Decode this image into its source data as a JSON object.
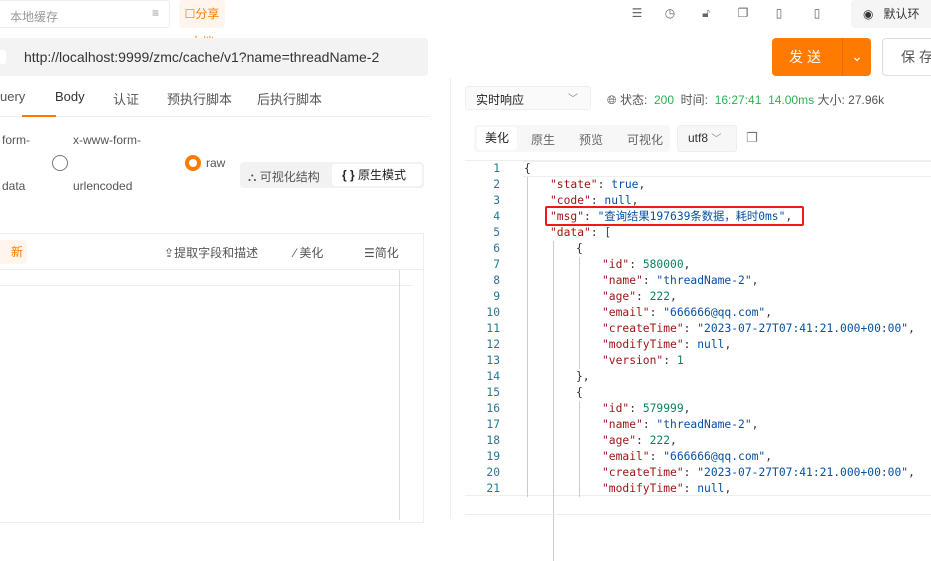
{
  "topbar": {
    "search_placeholder": "本地缓存",
    "share_label": "分享文档",
    "env_label": "默认环",
    "icons": [
      "list-icon",
      "clock-icon",
      "lock-icon",
      "copy-icon",
      "code-icon",
      "flash-icon"
    ]
  },
  "request": {
    "url": "http://localhost:9999/zmc/cache/v1?name=threadName-2",
    "send_label": "发送",
    "save_label": "保存"
  },
  "req_tabs": [
    {
      "label": "uery"
    },
    {
      "label": "Body",
      "active": true
    },
    {
      "label": "认证"
    },
    {
      "label": "预执行脚本"
    },
    {
      "label": "后执行脚本"
    }
  ],
  "body_types": {
    "form_data_1": "form-",
    "form_data_2": "data",
    "urlenc_1": "x-www-form-",
    "urlenc_2": "urlencoded",
    "raw": "raw",
    "selected": "raw"
  },
  "view_toggle": {
    "visual": "可视化结构",
    "raw": "原生模式"
  },
  "left_toolbar": {
    "new": "新",
    "extract": "提取字段和描述",
    "beautify": "美化",
    "simplify": "简化"
  },
  "response": {
    "mode": "实时响应",
    "status_label": "状态:",
    "status": "200",
    "time_label": "时间:",
    "time": "16:27:41",
    "duration": "14.00ms",
    "size_label": "大小:",
    "size": "27.96k",
    "tabs": [
      "美化",
      "原生",
      "预览",
      "可视化"
    ],
    "active_tab": "美化",
    "encoding": "utf8"
  },
  "colors": {
    "accent": "#ff7a00",
    "success": "#2bb24c",
    "highlight_box": "#f01818"
  },
  "code_lines": [
    {
      "i": 0,
      "t": [
        [
          "p",
          "{"
        ]
      ]
    },
    {
      "i": 1,
      "t": [
        [
          "k",
          "\"state\""
        ],
        [
          "p",
          ": "
        ],
        [
          "b",
          "true"
        ],
        [
          "p",
          ","
        ]
      ]
    },
    {
      "i": 1,
      "t": [
        [
          "k",
          "\"code\""
        ],
        [
          "p",
          ": "
        ],
        [
          "b",
          "null"
        ],
        [
          "p",
          ","
        ]
      ]
    },
    {
      "i": 1,
      "t": [
        [
          "k",
          "\"msg\""
        ],
        [
          "p",
          ": "
        ],
        [
          "s",
          "\"查询结果197639条数据，耗时0ms\""
        ],
        [
          "p",
          ","
        ]
      ]
    },
    {
      "i": 1,
      "t": [
        [
          "k",
          "\"data\""
        ],
        [
          "p",
          ": "
        ],
        [
          "s",
          "["
        ]
      ]
    },
    {
      "i": 2,
      "t": [
        [
          "p",
          "{"
        ]
      ]
    },
    {
      "i": 3,
      "t": [
        [
          "k",
          "\"id\""
        ],
        [
          "p",
          ": "
        ],
        [
          "n",
          "580000"
        ],
        [
          "p",
          ","
        ]
      ]
    },
    {
      "i": 3,
      "t": [
        [
          "k",
          "\"name\""
        ],
        [
          "p",
          ": "
        ],
        [
          "s",
          "\"threadName-2\""
        ],
        [
          "p",
          ","
        ]
      ]
    },
    {
      "i": 3,
      "t": [
        [
          "k",
          "\"age\""
        ],
        [
          "p",
          ": "
        ],
        [
          "n",
          "222"
        ],
        [
          "p",
          ","
        ]
      ]
    },
    {
      "i": 3,
      "t": [
        [
          "k",
          "\"email\""
        ],
        [
          "p",
          ": "
        ],
        [
          "s",
          "\"666666@qq.com\""
        ],
        [
          "p",
          ","
        ]
      ]
    },
    {
      "i": 3,
      "t": [
        [
          "k",
          "\"createTime\""
        ],
        [
          "p",
          ": "
        ],
        [
          "s",
          "\"2023-07-27T07:41:21.000+00:00\""
        ],
        [
          "p",
          ","
        ]
      ]
    },
    {
      "i": 3,
      "t": [
        [
          "k",
          "\"modifyTime\""
        ],
        [
          "p",
          ": "
        ],
        [
          "b",
          "null"
        ],
        [
          "p",
          ","
        ]
      ]
    },
    {
      "i": 3,
      "t": [
        [
          "k",
          "\"version\""
        ],
        [
          "p",
          ": "
        ],
        [
          "n",
          "1"
        ]
      ]
    },
    {
      "i": 2,
      "t": [
        [
          "p",
          "},"
        ]
      ]
    },
    {
      "i": 2,
      "t": [
        [
          "p",
          "{"
        ]
      ]
    },
    {
      "i": 3,
      "t": [
        [
          "k",
          "\"id\""
        ],
        [
          "p",
          ": "
        ],
        [
          "n",
          "579999"
        ],
        [
          "p",
          ","
        ]
      ]
    },
    {
      "i": 3,
      "t": [
        [
          "k",
          "\"name\""
        ],
        [
          "p",
          ": "
        ],
        [
          "s",
          "\"threadName-2\""
        ],
        [
          "p",
          ","
        ]
      ]
    },
    {
      "i": 3,
      "t": [
        [
          "k",
          "\"age\""
        ],
        [
          "p",
          ": "
        ],
        [
          "n",
          "222"
        ],
        [
          "p",
          ","
        ]
      ]
    },
    {
      "i": 3,
      "t": [
        [
          "k",
          "\"email\""
        ],
        [
          "p",
          ": "
        ],
        [
          "s",
          "\"666666@qq.com\""
        ],
        [
          "p",
          ","
        ]
      ]
    },
    {
      "i": 3,
      "t": [
        [
          "k",
          "\"createTime\""
        ],
        [
          "p",
          ": "
        ],
        [
          "s",
          "\"2023-07-27T07:41:21.000+00:00\""
        ],
        [
          "p",
          ","
        ]
      ]
    },
    {
      "i": 3,
      "t": [
        [
          "k",
          "\"modifyTime\""
        ],
        [
          "p",
          ": "
        ],
        [
          "b",
          "null"
        ],
        [
          "p",
          ","
        ]
      ]
    }
  ]
}
